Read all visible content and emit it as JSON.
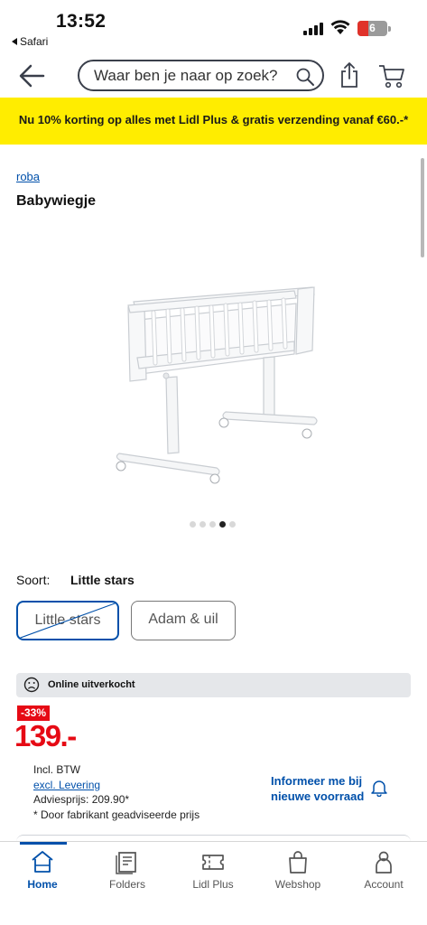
{
  "status_bar": {
    "time": "13:52",
    "back_app": "Safari",
    "battery_level": "6",
    "icons": [
      "signal-icon",
      "wifi-icon",
      "battery-icon"
    ]
  },
  "header": {
    "search_placeholder": "Waar ben je naar op zoek?",
    "icons": [
      "back-arrow-icon",
      "search-icon",
      "share-icon",
      "cart-icon"
    ]
  },
  "promo": {
    "text": "Nu 10% korting op alles met Lidl Plus & gratis verzending vanaf €60.-*",
    "color": "#ffed00"
  },
  "product": {
    "brand": "roba",
    "title": "Babywiegje",
    "image_count": 5,
    "active_image": 4
  },
  "variant": {
    "label": "Soort:",
    "selected": "Little stars",
    "options": [
      "Little stars",
      "Adam & uil"
    ]
  },
  "stock": {
    "text": "Online uitverkocht",
    "icon": "sad-face-icon"
  },
  "pricing": {
    "discount": "-33%",
    "price": "139.-",
    "incl_vat": "Incl. BTW",
    "shipping_link": "excl. Levering",
    "advice_price": "Adviesprijs: 209.90*",
    "footnote": "* Door fabrikant geadviseerde prijs",
    "price_color": "#e60a14"
  },
  "notify": {
    "line1": "Informeer me bij",
    "line2": "nieuwe voorraad",
    "icon": "bell-icon"
  },
  "nav": {
    "items": [
      {
        "label": "Home",
        "icon": "home-icon",
        "active": true
      },
      {
        "label": "Folders",
        "icon": "folders-icon",
        "active": false
      },
      {
        "label": "Lidl Plus",
        "icon": "lidl-plus-icon",
        "active": false
      },
      {
        "label": "Webshop",
        "icon": "shopping-bag-icon",
        "active": false
      },
      {
        "label": "Account",
        "icon": "account-icon",
        "active": false
      }
    ],
    "accent": "#0050aa"
  }
}
